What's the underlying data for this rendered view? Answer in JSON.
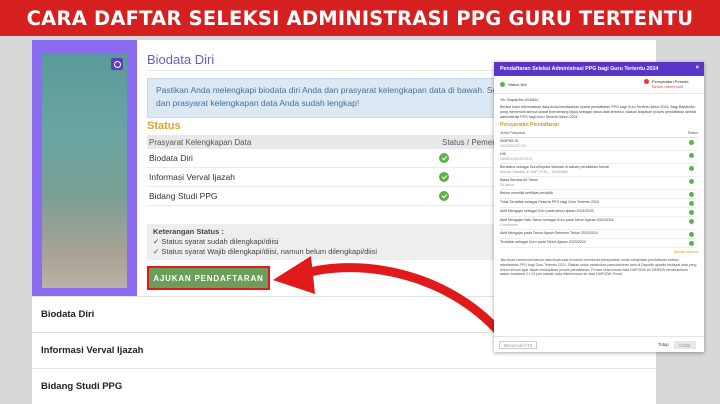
{
  "banner": {
    "title": "CARA DAFTAR SELEKSI ADMINISTRASI PPG GURU TERTENTU"
  },
  "biodata": {
    "title": "Biodata Diri",
    "info": "Pastikan Anda melengkapi biodata diri Anda dan prasyarat kelengkapan data di bawah. Selanjutnya silakan lengkapi biodata diri dan prasyarat kelengkapan data Anda sudah lengkap!"
  },
  "status": {
    "title": "Status",
    "col_prasyarat": "Prasyarat Kelengkapan Data",
    "col_status": "Status / Pemenuhan",
    "rows": [
      {
        "label": "Biodata Diri",
        "status": "complete"
      },
      {
        "label": "Informasi Verval Ijazah",
        "status": "complete"
      },
      {
        "label": "Bidang Studi PPG",
        "status": "complete"
      }
    ],
    "legend_title": "Keterangan Status :",
    "legend_1": "Status syarat sudah dilengkapi/diisi",
    "legend_2": "Status syarat Wajib dilengkapi/diisi, namun belum dilengkapi/diisi"
  },
  "apply_button": "AJUKAN PENDAFTARAN",
  "accordion": [
    "Biodata Diri",
    "Informasi Verval Ijazah",
    "Bidang Studi PPG"
  ],
  "highlight_color": "#e01a1a",
  "accent_color": "#5b35c9",
  "modal": {
    "title": "Pendaftaran Seleksi Administrasi PPG bagi Guru Tertentu 2024",
    "close": "×",
    "step1": "Status NIK",
    "step2": "Persyaratan Peserta",
    "step2_sub": "Belum memenuhi",
    "greeting": "Yth. Bapak/Ibu USMAN,",
    "intro": "Berikut kami informasikan data Anda berdasarkan syarat pendaftaran PPG bagi Guru Tertentu tahun 2024. Bagi Bapak/Ibu yang memenuhi semua syarat (bercentang hijau) sebagai mana data tersebut, silakan lanjutkan proses pendaftaran seleksi administrasi PPG bagi Guru Tertentu tahun 2024.",
    "section": "Persyaratan Pendaftaran",
    "col_jenis": "Jenis Prasyarat",
    "col_status": "Status",
    "rows": [
      {
        "label": "SIMPKB ID",
        "sub": "1022002437193"
      },
      {
        "label": "NIK",
        "sub": "1808031501970013"
      },
      {
        "label": "Berstatus sebagai Guru/Kepala Sekolah di satuan pendidikan formal",
        "sub": "Kepala Sekolah di SMP YCKL - 1234NWN"
      },
      {
        "label": "Batas Berusia 60 Tahun",
        "sub": "34 tahun"
      },
      {
        "label": "Belum memiliki sertifikat pendidik",
        "sub": ""
      },
      {
        "label": "Tidak Terdaftar sebagai Peserta PPG bagi Guru Tertentu 2024",
        "sub": ""
      },
      {
        "label": "Aktif Mengajar sebagai Guru pada tahun ajaran 2024/2025",
        "sub": ""
      },
      {
        "label": "Aktif Mengajar Satu Tahun sebagai Guru pada Tahun Ajaran 2023/2024",
        "sub": "2 semester"
      },
      {
        "label": "Aktif Mengajar pada Tahun Ajaran Sebelum Tahun 2023/2024",
        "sub": ""
      },
      {
        "label": "Terdaftar sebagai Guru pada Tahun Ajaran 2023/2024",
        "sub": ""
      }
    ],
    "link": "Ajukan request",
    "note": "Jika Anda memenuhi bahwa data Anda saat ini belum memenuhi persyaratan untuk melakukan pendaftaran seleksi administrasi PPG bagi Guru Tertentu 2024. Silakan untuk melakukan pemutakhiran data di Dapodik apabila terdapat data yang belum sesuai agar dapat melanjutkan proses pendaftaran. Proses sinkronisasi data DAPODIK ke SIMPKB membutuhkan waktu maksimal 2 x 24 jam setelah data disinkronkan ke data DAPODIK Pusat.",
    "btn_left": "Memenuhi KTS",
    "btn_close": "Tutup",
    "btn_submit": "Daftar"
  }
}
